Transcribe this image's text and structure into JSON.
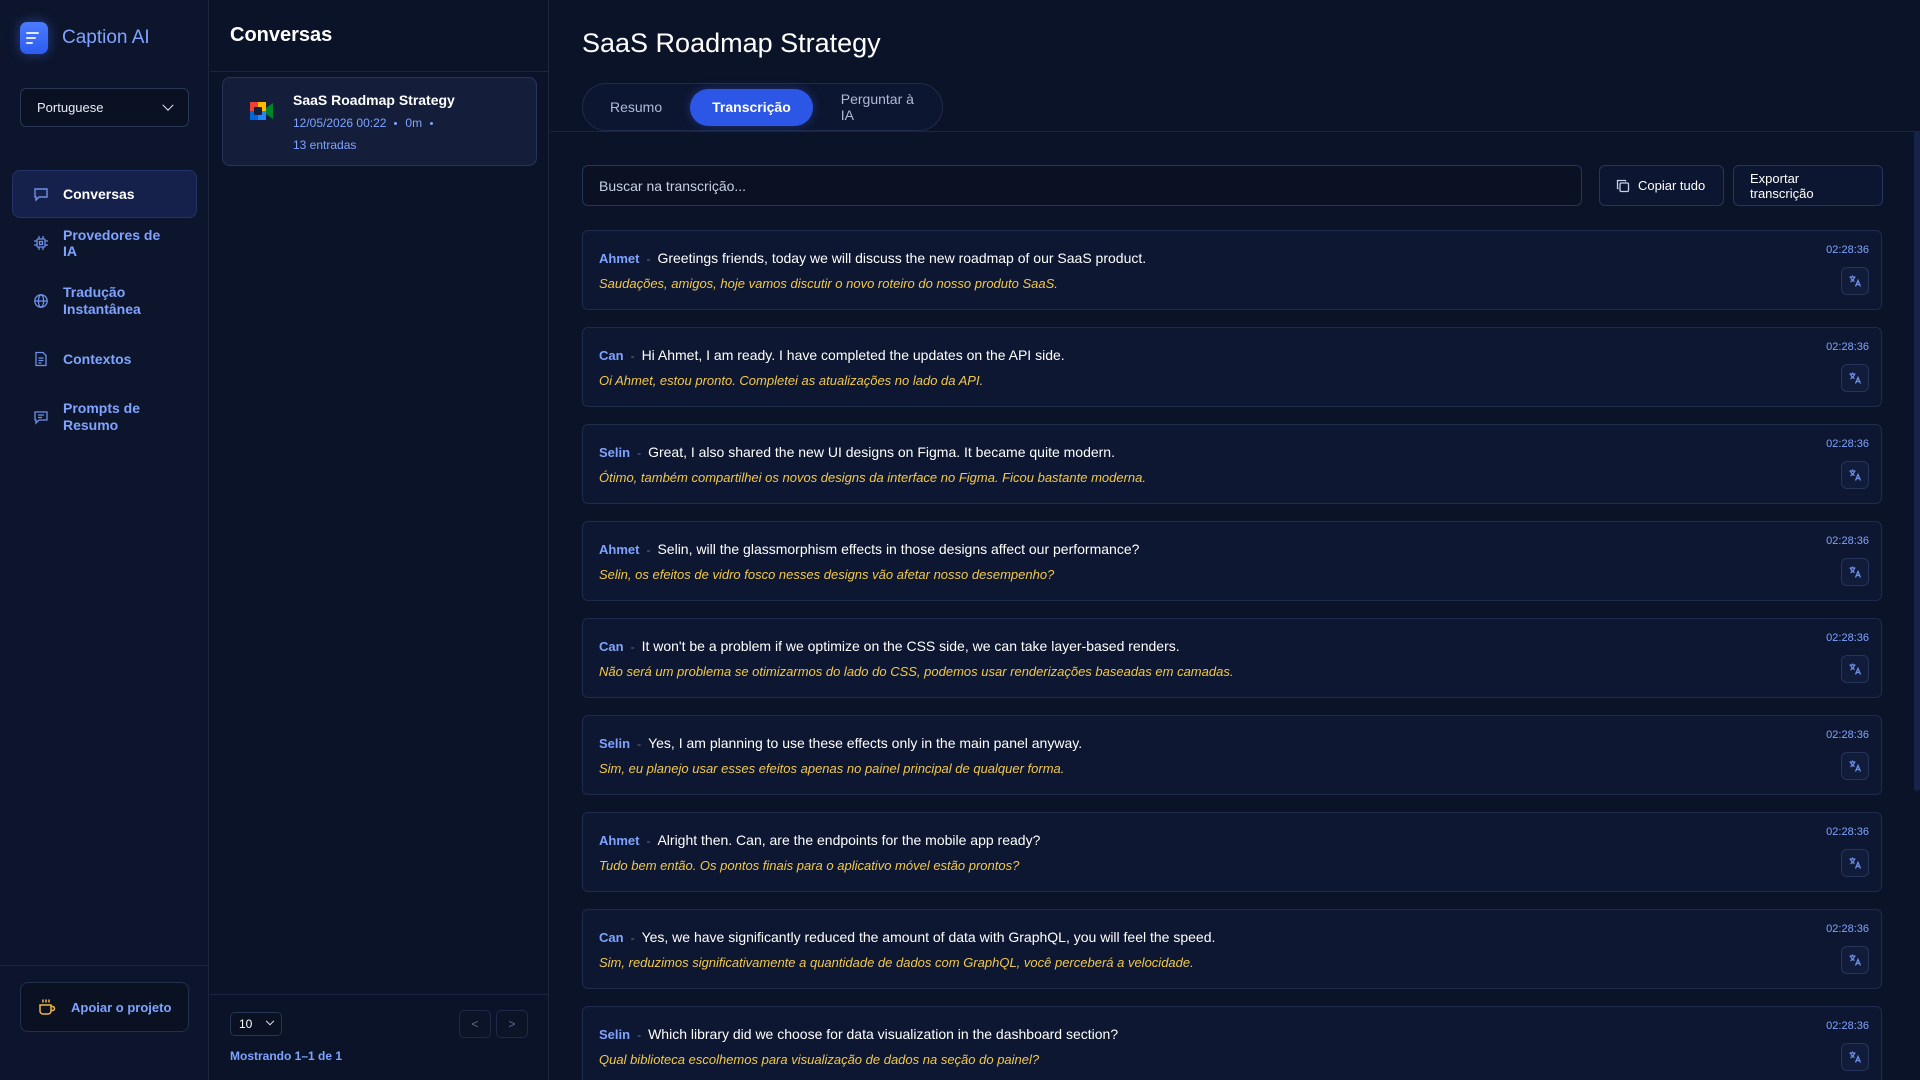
{
  "app": {
    "name": "Caption AI",
    "icon": "caption-logo-icon"
  },
  "sidebar": {
    "language": "Portuguese",
    "items": [
      {
        "label": "Conversas",
        "icon": "chat-icon",
        "active": true
      },
      {
        "label": "Provedores de IA",
        "icon": "chip-icon",
        "active": false
      },
      {
        "label": "Tradução Instantânea",
        "icon": "globe-icon",
        "active": false
      },
      {
        "label": "Contextos",
        "icon": "document-icon",
        "active": false
      },
      {
        "label": "Prompts de Resumo",
        "icon": "message-square-icon",
        "active": false
      }
    ],
    "support_label": "Apoiar o projeto"
  },
  "conversations": {
    "title": "Conversas",
    "items": [
      {
        "title": "SaaS Roadmap Strategy",
        "date": "12/05/2026 00:22",
        "duration": "0m",
        "entries": "13 entradas",
        "icon": "google-meet-icon"
      }
    ],
    "page_size": "10",
    "prev": "<",
    "next": ">",
    "showing": "Mostrando 1–1 de 1"
  },
  "main": {
    "title": "SaaS Roadmap Strategy",
    "tabs": [
      {
        "label": "Resumo",
        "active": false
      },
      {
        "label": "Transcrição",
        "active": true
      },
      {
        "label": "Perguntar à IA",
        "active": false
      }
    ],
    "search_placeholder": "Buscar na transcrição...",
    "copy_all": "Copiar tudo",
    "export": "Exportar transcrição",
    "entries": [
      {
        "speaker": "Ahmet",
        "sep": "-",
        "text": "Greetings friends, today we will discuss the new roadmap of our SaaS product.",
        "translation": "Saudações, amigos, hoje vamos discutir o novo roteiro do nosso produto SaaS.",
        "time": "02:28:36"
      },
      {
        "speaker": "Can",
        "sep": "-",
        "text": "Hi Ahmet, I am ready. I have completed the updates on the API side.",
        "translation": "Oi Ahmet, estou pronto. Completei as atualizações no lado da API.",
        "time": "02:28:36"
      },
      {
        "speaker": "Selin",
        "sep": "-",
        "text": "Great, I also shared the new UI designs on Figma. It became quite modern.",
        "translation": "Ótimo, também compartilhei os novos designs da interface no Figma. Ficou bastante moderna.",
        "time": "02:28:36"
      },
      {
        "speaker": "Ahmet",
        "sep": "-",
        "text": "Selin, will the glassmorphism effects in those designs affect our performance?",
        "translation": "Selin, os efeitos de vidro fosco nesses designs vão afetar nosso desempenho?",
        "time": "02:28:36"
      },
      {
        "speaker": "Can",
        "sep": "-",
        "text": "It won't be a problem if we optimize on the CSS side, we can take layer-based renders.",
        "translation": "Não será um problema se otimizarmos do lado do CSS, podemos usar renderizações baseadas em camadas.",
        "time": "02:28:36"
      },
      {
        "speaker": "Selin",
        "sep": "-",
        "text": "Yes, I am planning to use these effects only in the main panel anyway.",
        "translation": "Sim, eu planejo usar esses efeitos apenas no painel principal de qualquer forma.",
        "time": "02:28:36"
      },
      {
        "speaker": "Ahmet",
        "sep": "-",
        "text": "Alright then. Can, are the endpoints for the mobile app ready?",
        "translation": "Tudo bem então. Os pontos finais para o aplicativo móvel estão prontos?",
        "time": "02:28:36"
      },
      {
        "speaker": "Can",
        "sep": "-",
        "text": "Yes, we have significantly reduced the amount of data with GraphQL, you will feel the speed.",
        "translation": "Sim, reduzimos significativamente a quantidade de dados com GraphQL, você perceberá a velocidade.",
        "time": "02:28:36"
      },
      {
        "speaker": "Selin",
        "sep": "-",
        "text": "Which library did we choose for data visualization in the dashboard section?",
        "translation": "Qual biblioteca escolhemos para visualização de dados na seção do painel?",
        "time": "02:28:36"
      }
    ]
  },
  "colors": {
    "accent": "#2c56e5",
    "speaker": "#7fa3ff",
    "translation": "#f1c84b",
    "background": "#0b1328"
  }
}
